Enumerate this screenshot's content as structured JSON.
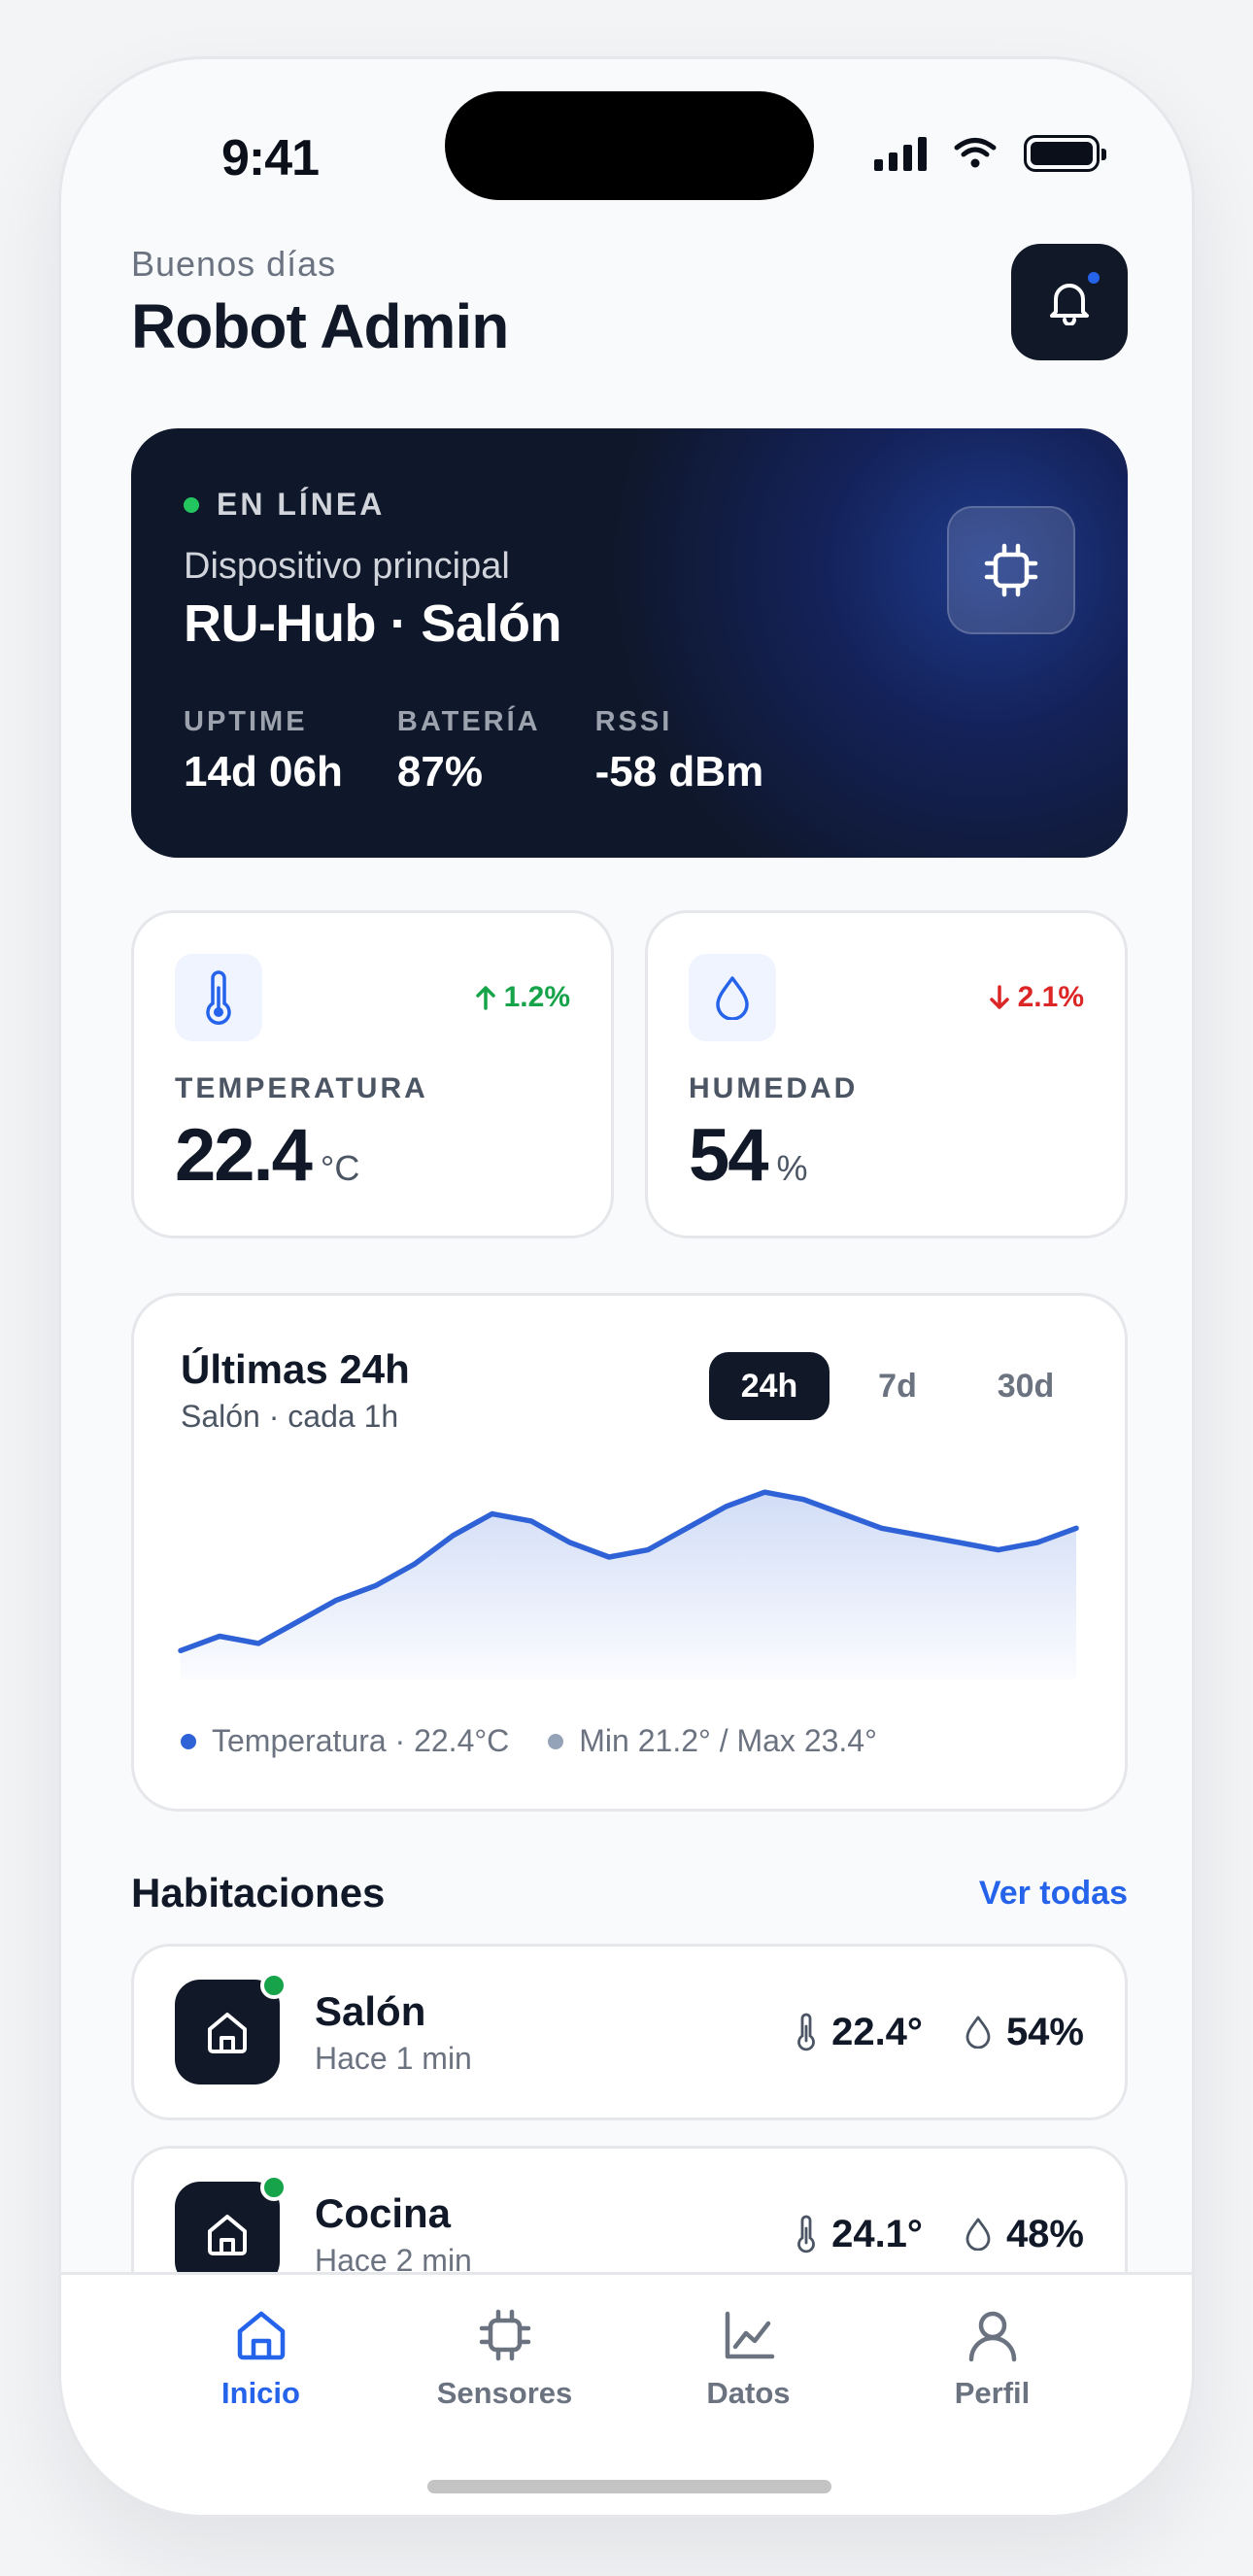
{
  "status_bar": {
    "time": "9:41"
  },
  "header": {
    "greeting": "Buenos días",
    "user_name": "Robot Admin"
  },
  "device": {
    "status": "EN LÍNEA",
    "subtitle": "Dispositivo principal",
    "name": "RU-Hub · Salón",
    "stats": [
      {
        "label": "UPTIME",
        "value": "14d 06h"
      },
      {
        "label": "BATERÍA",
        "value": "87%"
      },
      {
        "label": "RSSI",
        "value": "-58 dBm"
      }
    ]
  },
  "metrics": [
    {
      "label": "TEMPERATURA",
      "value": "22.4",
      "unit": "°C",
      "trend": "1.2%",
      "trend_dir": "up",
      "icon": "thermometer-icon"
    },
    {
      "label": "HUMEDAD",
      "value": "54",
      "unit": "%",
      "trend": "2.1%",
      "trend_dir": "down",
      "icon": "droplet-icon"
    }
  ],
  "chart_card": {
    "title": "Últimas 24h",
    "subtitle": "Salón · cada 1h",
    "tabs": [
      "24h",
      "7d",
      "30d"
    ],
    "active_tab": "24h",
    "legend_primary": "Temperatura · 22.4°C",
    "legend_secondary": "Min 21.2° / Max 23.4°"
  },
  "chart_data": {
    "type": "area",
    "series": [
      {
        "values": [
          21.2,
          21.4,
          21.3,
          21.6,
          21.9,
          22.1,
          22.4,
          22.8,
          23.1,
          23.0,
          22.7,
          22.5,
          22.6,
          22.9,
          23.2,
          23.4,
          23.3,
          23.1,
          22.9,
          22.8,
          22.7,
          22.6,
          22.7,
          22.9
        ]
      }
    ],
    "ylim": [
      20.8,
      23.7
    ],
    "grid": false,
    "line_color": "#2f62d6"
  },
  "rooms_section": {
    "title": "Habitaciones",
    "see_all": "Ver todas"
  },
  "rooms": [
    {
      "name": "Salón",
      "updated": "Hace 1 min",
      "temp": "22.4°",
      "humidity": "54%"
    },
    {
      "name": "Cocina",
      "updated": "Hace 2 min",
      "temp": "24.1°",
      "humidity": "48%"
    }
  ],
  "nav": [
    {
      "label": "Inicio",
      "icon": "home-icon",
      "active": true
    },
    {
      "label": "Sensores",
      "icon": "chip-icon",
      "active": false
    },
    {
      "label": "Datos",
      "icon": "line-chart-icon",
      "active": false
    },
    {
      "label": "Perfil",
      "icon": "user-icon",
      "active": false
    }
  ],
  "colors": {
    "accent": "#2563eb",
    "dark": "#111827",
    "online": "#16a34a",
    "trend_up": "#16a34a",
    "trend_down": "#dc2626"
  }
}
